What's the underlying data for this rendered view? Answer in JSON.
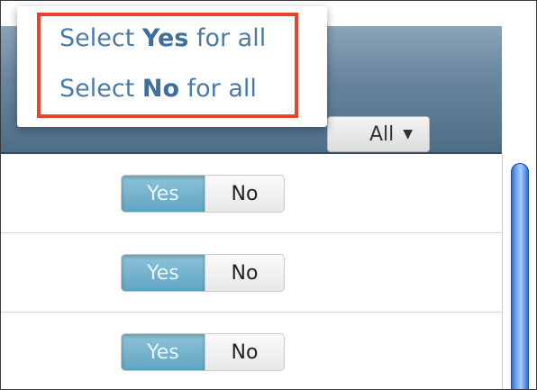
{
  "dropdown": {
    "items": [
      {
        "prefix": "Select ",
        "bold": "Yes",
        "suffix": " for all"
      },
      {
        "prefix": "Select ",
        "bold": "No",
        "suffix": " for all"
      }
    ]
  },
  "header": {
    "all_button_label": "All",
    "all_button_caret": "▼"
  },
  "rows": [
    {
      "yes_label": "Yes",
      "no_label": "No",
      "selected": "Yes"
    },
    {
      "yes_label": "Yes",
      "no_label": "No",
      "selected": "Yes"
    },
    {
      "yes_label": "Yes",
      "no_label": "No",
      "selected": "Yes"
    }
  ],
  "colors": {
    "highlight_border": "#e8432b",
    "link_text": "#4a7aa7",
    "yes_selected": "#5fa5c3",
    "header_band": "#5f7e97",
    "scroll_thumb": "#4f8ee6"
  }
}
